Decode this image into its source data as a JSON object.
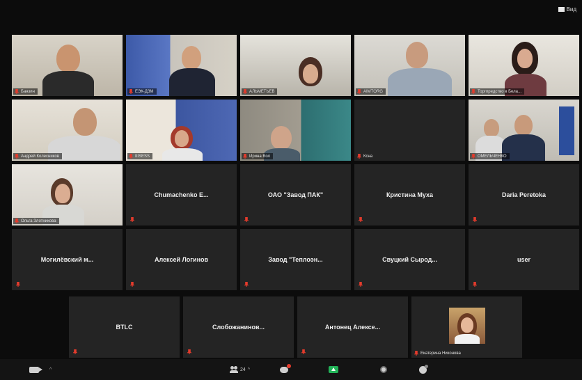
{
  "topbar": {
    "view_label": "Вид"
  },
  "row1": [
    {
      "name": "Баязин",
      "scene": "office1"
    },
    {
      "name": "ЕЭК-ДЗМ",
      "scene": "eek"
    },
    {
      "name": "АЛЬМЕТЬЕВ",
      "scene": "office2"
    },
    {
      "name": "AIMTORG",
      "scene": "office3"
    },
    {
      "name": "Торгпредство в Бела...",
      "scene": "office4"
    }
  ],
  "row2": [
    {
      "name": "Андрей Колесников",
      "scene": "office5"
    },
    {
      "name": "IIISESS",
      "scene": "eek2"
    },
    {
      "name": "Ирина Вол",
      "scene": "shelves"
    },
    {
      "name": "Ксна",
      "scene": "dark"
    },
    {
      "name": "ОМЕЛЬЧЕНКО",
      "scene": "office6",
      "active": true
    }
  ],
  "row3": [
    {
      "name": "Ольга Злотникова",
      "scene": "office7"
    },
    {
      "name": "Chumachenko E...",
      "scene": "none"
    },
    {
      "name": "ОАО \"Завод ПАК\"",
      "scene": "none"
    },
    {
      "name": "Кристина Муха",
      "scene": "none"
    },
    {
      "name": "Daria Peretoka",
      "scene": "none"
    }
  ],
  "row4": [
    {
      "name": "Могилёвский м...",
      "scene": "none"
    },
    {
      "name": "Алексей Логинов",
      "scene": "none"
    },
    {
      "name": "Завод \"Теплоэн...",
      "scene": "none"
    },
    {
      "name": "Свуцкий Сырод...",
      "scene": "none"
    },
    {
      "name": "user",
      "scene": "none"
    }
  ],
  "row5": [
    {
      "name": "BTLC",
      "scene": "none"
    },
    {
      "name": "Слобожанинов...",
      "scene": "none"
    },
    {
      "name": "Антонец Алексе...",
      "scene": "none"
    },
    {
      "name": "Екатерина Никонова",
      "scene": "avatar"
    }
  ],
  "bottombar": {
    "participants_count": "24"
  },
  "colors": {
    "active_border": "#d7e25a",
    "muted_mic": "#e43b2c",
    "share_green": "#22b358"
  }
}
